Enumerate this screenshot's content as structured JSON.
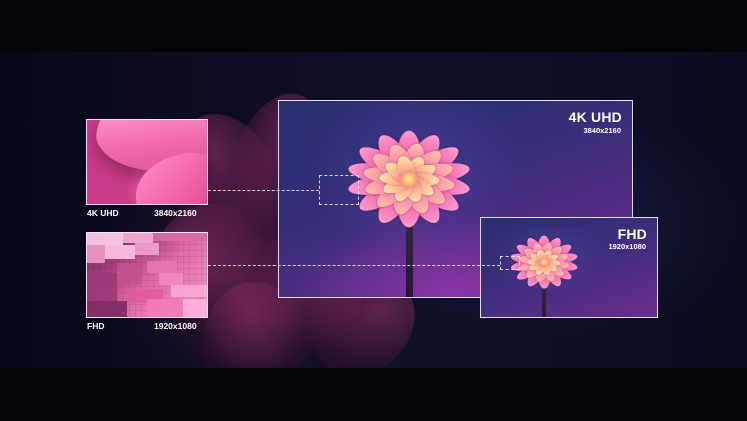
{
  "panels": {
    "uhd_main": {
      "label": "4K UHD",
      "resolution": "3840x2160"
    },
    "fhd_main": {
      "label": "FHD",
      "resolution": "1920x1080"
    },
    "uhd_zoom": {
      "label": "4K UHD",
      "resolution": "3840x2160"
    },
    "fhd_zoom": {
      "label": "FHD",
      "resolution": "1920x1080"
    }
  },
  "colors": {
    "background": "#05060b",
    "petal_pink": "#f35fa9",
    "petal_highlight": "#ffd9a0",
    "panel_border": "#ffffff"
  }
}
